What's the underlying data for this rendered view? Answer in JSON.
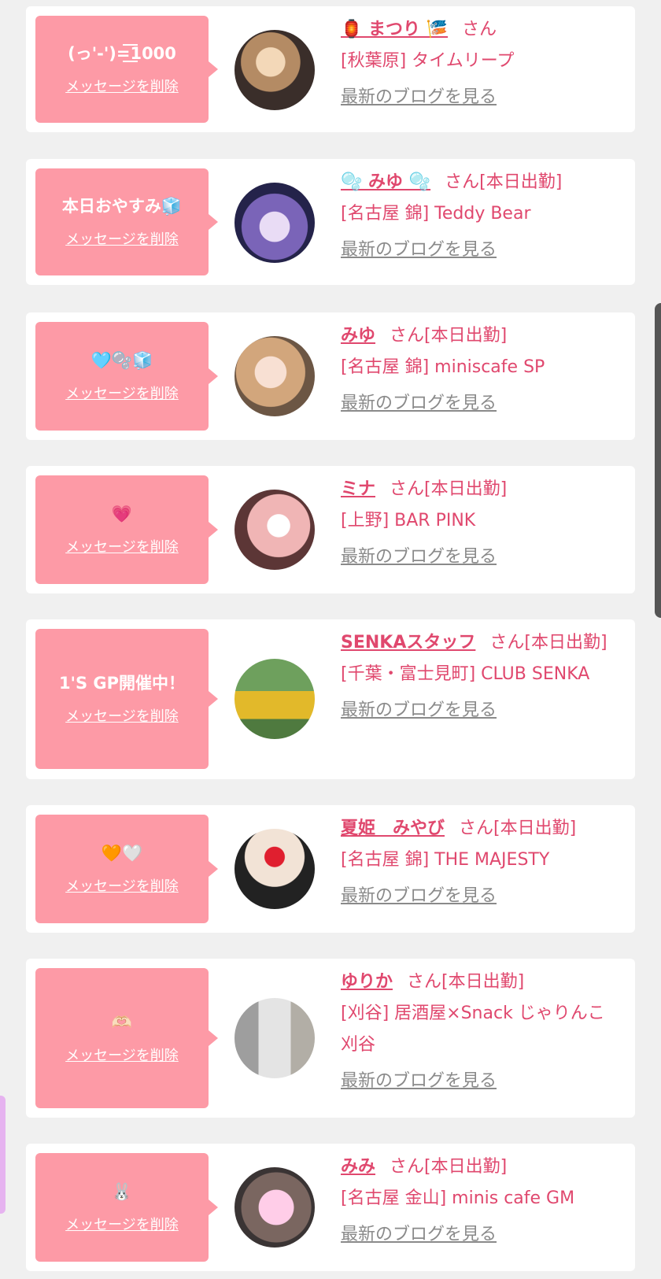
{
  "delete_label": "メッセージを削除",
  "blog_label": "最新のブログを見る",
  "entries": [
    {
      "message": "(っ'-')=͟͟͞͞1000",
      "name": "🏮 まつり 🎏",
      "suffix": "さん",
      "shop": "[秋葉原] タイムリープ",
      "avatar": "avatar"
    },
    {
      "message": "本日おやすみ🧊",
      "name": "🫧 みゆ 🫧",
      "suffix": "さん[本日出勤]",
      "shop": "[名古屋 錦] Teddy Bear",
      "avatar": "avatar"
    },
    {
      "message": "🩵🫧🧊",
      "name": "みゆ",
      "suffix": "さん[本日出勤]",
      "shop": "[名古屋 錦] miniscafe SP",
      "avatar": "avatar"
    },
    {
      "message": "💗",
      "name": "ミナ",
      "suffix": "さん[本日出勤]",
      "shop": "[上野] BAR PINK",
      "avatar": "avatar"
    },
    {
      "message": "1'S GP開催中！",
      "name": "SENKAスタッフ",
      "suffix": "さん[本日出勤]",
      "shop": "[千葉・富士見町] CLUB SENKA",
      "avatar": "avatar"
    },
    {
      "message": "🧡🤍",
      "name": "夏姫　みやび",
      "suffix": "さん[本日出勤]",
      "shop": "[名古屋 錦] THE MAJESTY",
      "avatar": "avatar"
    },
    {
      "message": "🫶🏻",
      "name": "ゆりか",
      "suffix": "さん[本日出勤]",
      "shop": "[刈谷] 居酒屋×Snack じゃりんこ刈谷",
      "avatar": "avatar"
    },
    {
      "message": "🐰",
      "name": "みみ",
      "suffix": "さん[本日出勤]",
      "shop": "[名古屋 金山] minis cafe GM",
      "avatar": "avatar"
    }
  ]
}
